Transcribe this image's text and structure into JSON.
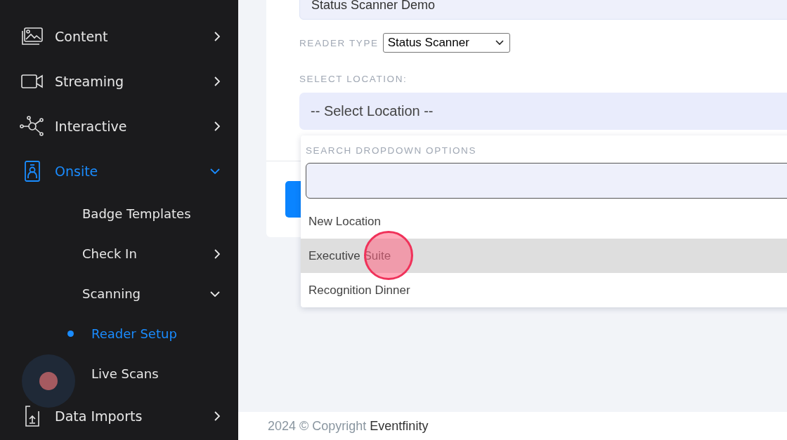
{
  "sidebar": {
    "items": [
      {
        "label": "Content",
        "expanded": false,
        "selected": false
      },
      {
        "label": "Streaming",
        "expanded": false,
        "selected": false
      },
      {
        "label": "Interactive",
        "expanded": false,
        "selected": false
      },
      {
        "label": "Onsite",
        "expanded": true,
        "selected": true,
        "children": [
          {
            "label": "Badge Templates",
            "selected": false
          },
          {
            "label": "Check In",
            "expanded": false,
            "selected": false
          },
          {
            "label": "Scanning",
            "expanded": true,
            "selected": false,
            "children": [
              {
                "label": "Reader Setup",
                "selected": true
              },
              {
                "label": "Live Scans",
                "selected": false
              }
            ]
          }
        ]
      },
      {
        "label": "Data Imports",
        "expanded": false,
        "selected": false
      }
    ]
  },
  "form": {
    "name_value": "Status Scanner Demo",
    "reader_type": {
      "label": "READER TYPE",
      "value": "Status Scanner"
    },
    "location": {
      "label": "SELECT LOCATION:",
      "value": "-- Select Location --"
    },
    "dropdown": {
      "search_label": "SEARCH DROPDOWN OPTIONS",
      "options": [
        {
          "label": "New Location",
          "selected": false
        },
        {
          "label": "Executive Suite",
          "selected": true
        },
        {
          "label": "Recognition Dinner",
          "selected": false
        }
      ]
    }
  },
  "footer": {
    "copyright": "2024 © Copyright",
    "brand": "Eventfinity"
  }
}
